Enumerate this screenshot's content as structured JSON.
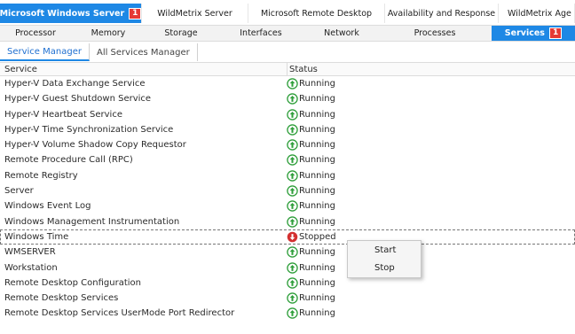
{
  "top_tabs": [
    {
      "label": "Microsoft Windows Server",
      "badge": "1",
      "active": true
    },
    {
      "label": "WildMetrix Server"
    },
    {
      "label": "Microsoft Remote Desktop"
    },
    {
      "label": "Availability and Response"
    },
    {
      "label": "WildMetrix Age"
    }
  ],
  "sub_tabs": [
    {
      "label": "Processor"
    },
    {
      "label": "Memory"
    },
    {
      "label": "Storage"
    },
    {
      "label": "Interfaces"
    },
    {
      "label": "Network"
    },
    {
      "label": "Processes"
    },
    {
      "label": "Services",
      "badge": "1",
      "active": true
    }
  ],
  "manager_tabs": [
    {
      "label": "Service Manager",
      "active": true
    },
    {
      "label": "All Services Manager"
    }
  ],
  "grid": {
    "headers": {
      "service": "Service",
      "status": "Status"
    },
    "rows": [
      {
        "service": "Hyper-V Data Exchange Service",
        "status": "Running"
      },
      {
        "service": "Hyper-V Guest Shutdown Service",
        "status": "Running"
      },
      {
        "service": "Hyper-V Heartbeat Service",
        "status": "Running"
      },
      {
        "service": "Hyper-V Time Synchronization Service",
        "status": "Running"
      },
      {
        "service": "Hyper-V Volume Shadow Copy Requestor",
        "status": "Running"
      },
      {
        "service": "Remote Procedure Call (RPC)",
        "status": "Running"
      },
      {
        "service": "Remote Registry",
        "status": "Running"
      },
      {
        "service": "Server",
        "status": "Running"
      },
      {
        "service": "Windows Event Log",
        "status": "Running"
      },
      {
        "service": "Windows Management Instrumentation",
        "status": "Running"
      },
      {
        "service": "Windows Time",
        "status": "Stopped",
        "selected": true
      },
      {
        "service": "WMSERVER",
        "status": "Running"
      },
      {
        "service": "Workstation",
        "status": "Running"
      },
      {
        "service": "Remote Desktop Configuration",
        "status": "Running"
      },
      {
        "service": "Remote Desktop Services",
        "status": "Running"
      },
      {
        "service": "Remote Desktop Services UserMode Port Redirector",
        "status": "Running"
      }
    ]
  },
  "context_menu": {
    "items": [
      "Start",
      "Stop"
    ]
  },
  "colors": {
    "accent": "#1e88e5",
    "badge": "#e53935",
    "running": "#2e9e3a",
    "stopped": "#d32f2f"
  },
  "icons": {
    "running": "arrow-up-circle-icon",
    "stopped": "arrow-down-circle-icon"
  }
}
